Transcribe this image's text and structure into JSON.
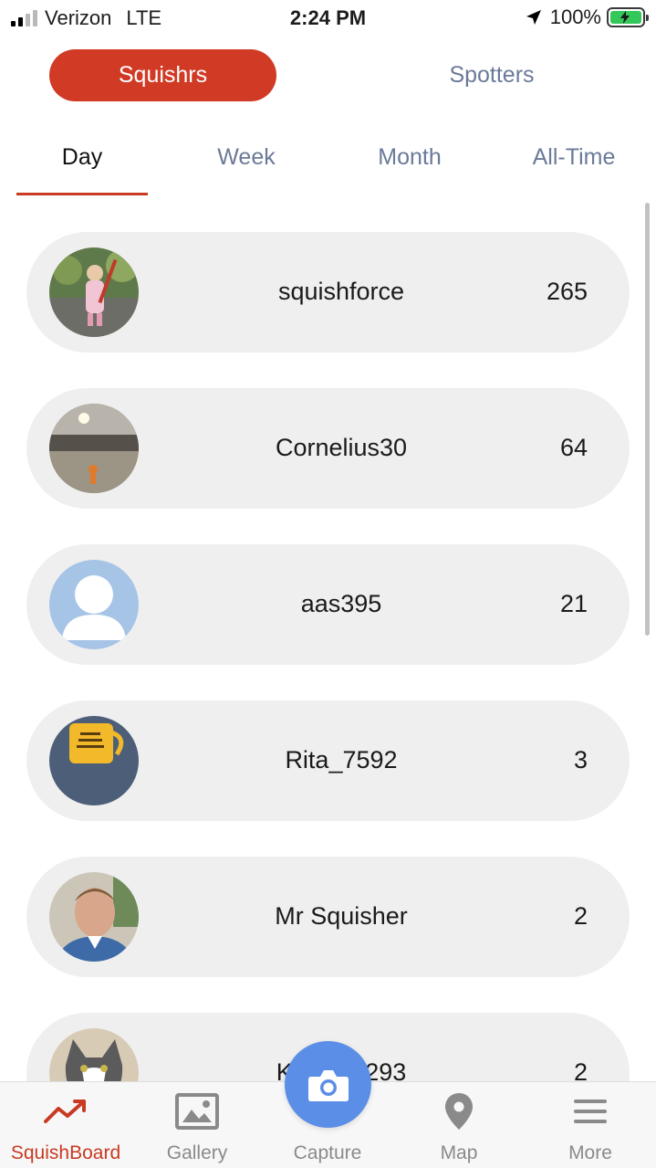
{
  "status_bar": {
    "carrier": "Verizon",
    "network": "LTE",
    "time": "2:24 PM",
    "battery": "100%"
  },
  "toggle": {
    "squishrs": "Squishrs",
    "spotters": "Spotters"
  },
  "tabs": [
    "Day",
    "Week",
    "Month",
    "All-Time"
  ],
  "leaderboard": [
    {
      "name": "squishforce",
      "score": "265",
      "avatar": "photo-child-outdoors"
    },
    {
      "name": "Cornelius30",
      "score": "64",
      "avatar": "photo-station"
    },
    {
      "name": "aas395",
      "score": "21",
      "avatar": "default-user-icon"
    },
    {
      "name": "Rita_7592",
      "score": "3",
      "avatar": "photo-yellow-mug"
    },
    {
      "name": "Mr Squisher",
      "score": "2",
      "avatar": "photo-man-portrait"
    },
    {
      "name": "Kyle_36293",
      "score": "2",
      "avatar": "photo-cat"
    }
  ],
  "bottom_nav": {
    "items": [
      "SquishBoard",
      "Gallery",
      "Capture",
      "Map",
      "More"
    ]
  },
  "colors": {
    "accent": "#d13a25",
    "inactive_text": "#6b7a99",
    "row_background": "#efefef",
    "capture_button": "#5b8ee6",
    "battery": "#34c759"
  }
}
